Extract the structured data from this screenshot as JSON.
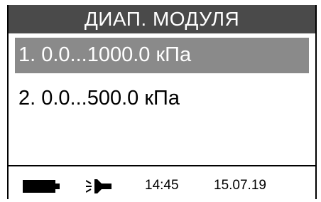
{
  "header": {
    "title": "ДИАП. МОДУЛЯ"
  },
  "menu": {
    "selected_index": 0,
    "items": [
      {
        "label": "1. 0.0...1000.0 кПа"
      },
      {
        "label": "2. 0.0...500.0 кПа"
      }
    ]
  },
  "status": {
    "battery_icon": "battery-icon",
    "power_icon": "power-plug-icon",
    "time": "14:45",
    "date": "15.07.19"
  },
  "colors": {
    "header_bg": "#4a4a4a",
    "selected_bg": "#8a8a8a",
    "text": "#000000",
    "background": "#ffffff"
  }
}
